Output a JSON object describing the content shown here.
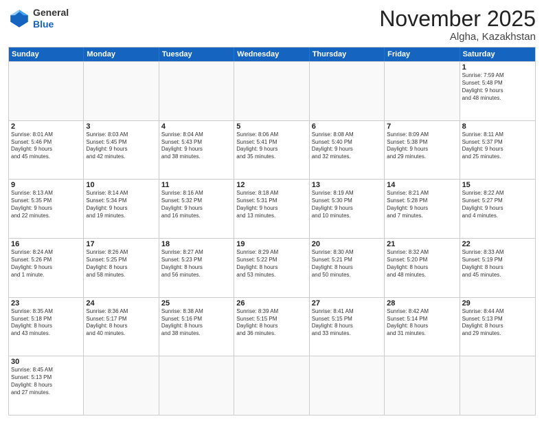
{
  "header": {
    "logo_general": "General",
    "logo_blue": "Blue",
    "month_title": "November 2025",
    "location": "Algha, Kazakhstan"
  },
  "days_of_week": [
    "Sunday",
    "Monday",
    "Tuesday",
    "Wednesday",
    "Thursday",
    "Friday",
    "Saturday"
  ],
  "rows": [
    [
      {
        "day": "",
        "info": ""
      },
      {
        "day": "",
        "info": ""
      },
      {
        "day": "",
        "info": ""
      },
      {
        "day": "",
        "info": ""
      },
      {
        "day": "",
        "info": ""
      },
      {
        "day": "",
        "info": ""
      },
      {
        "day": "1",
        "info": "Sunrise: 7:59 AM\nSunset: 5:48 PM\nDaylight: 9 hours\nand 48 minutes."
      }
    ],
    [
      {
        "day": "2",
        "info": "Sunrise: 8:01 AM\nSunset: 5:46 PM\nDaylight: 9 hours\nand 45 minutes."
      },
      {
        "day": "3",
        "info": "Sunrise: 8:03 AM\nSunset: 5:45 PM\nDaylight: 9 hours\nand 42 minutes."
      },
      {
        "day": "4",
        "info": "Sunrise: 8:04 AM\nSunset: 5:43 PM\nDaylight: 9 hours\nand 38 minutes."
      },
      {
        "day": "5",
        "info": "Sunrise: 8:06 AM\nSunset: 5:41 PM\nDaylight: 9 hours\nand 35 minutes."
      },
      {
        "day": "6",
        "info": "Sunrise: 8:08 AM\nSunset: 5:40 PM\nDaylight: 9 hours\nand 32 minutes."
      },
      {
        "day": "7",
        "info": "Sunrise: 8:09 AM\nSunset: 5:38 PM\nDaylight: 9 hours\nand 29 minutes."
      },
      {
        "day": "8",
        "info": "Sunrise: 8:11 AM\nSunset: 5:37 PM\nDaylight: 9 hours\nand 25 minutes."
      }
    ],
    [
      {
        "day": "9",
        "info": "Sunrise: 8:13 AM\nSunset: 5:35 PM\nDaylight: 9 hours\nand 22 minutes."
      },
      {
        "day": "10",
        "info": "Sunrise: 8:14 AM\nSunset: 5:34 PM\nDaylight: 9 hours\nand 19 minutes."
      },
      {
        "day": "11",
        "info": "Sunrise: 8:16 AM\nSunset: 5:32 PM\nDaylight: 9 hours\nand 16 minutes."
      },
      {
        "day": "12",
        "info": "Sunrise: 8:18 AM\nSunset: 5:31 PM\nDaylight: 9 hours\nand 13 minutes."
      },
      {
        "day": "13",
        "info": "Sunrise: 8:19 AM\nSunset: 5:30 PM\nDaylight: 9 hours\nand 10 minutes."
      },
      {
        "day": "14",
        "info": "Sunrise: 8:21 AM\nSunset: 5:28 PM\nDaylight: 9 hours\nand 7 minutes."
      },
      {
        "day": "15",
        "info": "Sunrise: 8:22 AM\nSunset: 5:27 PM\nDaylight: 9 hours\nand 4 minutes."
      }
    ],
    [
      {
        "day": "16",
        "info": "Sunrise: 8:24 AM\nSunset: 5:26 PM\nDaylight: 9 hours\nand 1 minute."
      },
      {
        "day": "17",
        "info": "Sunrise: 8:26 AM\nSunset: 5:25 PM\nDaylight: 8 hours\nand 58 minutes."
      },
      {
        "day": "18",
        "info": "Sunrise: 8:27 AM\nSunset: 5:23 PM\nDaylight: 8 hours\nand 56 minutes."
      },
      {
        "day": "19",
        "info": "Sunrise: 8:29 AM\nSunset: 5:22 PM\nDaylight: 8 hours\nand 53 minutes."
      },
      {
        "day": "20",
        "info": "Sunrise: 8:30 AM\nSunset: 5:21 PM\nDaylight: 8 hours\nand 50 minutes."
      },
      {
        "day": "21",
        "info": "Sunrise: 8:32 AM\nSunset: 5:20 PM\nDaylight: 8 hours\nand 48 minutes."
      },
      {
        "day": "22",
        "info": "Sunrise: 8:33 AM\nSunset: 5:19 PM\nDaylight: 8 hours\nand 45 minutes."
      }
    ],
    [
      {
        "day": "23",
        "info": "Sunrise: 8:35 AM\nSunset: 5:18 PM\nDaylight: 8 hours\nand 43 minutes."
      },
      {
        "day": "24",
        "info": "Sunrise: 8:36 AM\nSunset: 5:17 PM\nDaylight: 8 hours\nand 40 minutes."
      },
      {
        "day": "25",
        "info": "Sunrise: 8:38 AM\nSunset: 5:16 PM\nDaylight: 8 hours\nand 38 minutes."
      },
      {
        "day": "26",
        "info": "Sunrise: 8:39 AM\nSunset: 5:15 PM\nDaylight: 8 hours\nand 36 minutes."
      },
      {
        "day": "27",
        "info": "Sunrise: 8:41 AM\nSunset: 5:15 PM\nDaylight: 8 hours\nand 33 minutes."
      },
      {
        "day": "28",
        "info": "Sunrise: 8:42 AM\nSunset: 5:14 PM\nDaylight: 8 hours\nand 31 minutes."
      },
      {
        "day": "29",
        "info": "Sunrise: 8:44 AM\nSunset: 5:13 PM\nDaylight: 8 hours\nand 29 minutes."
      }
    ],
    [
      {
        "day": "30",
        "info": "Sunrise: 8:45 AM\nSunset: 5:13 PM\nDaylight: 8 hours\nand 27 minutes."
      },
      {
        "day": "",
        "info": ""
      },
      {
        "day": "",
        "info": ""
      },
      {
        "day": "",
        "info": ""
      },
      {
        "day": "",
        "info": ""
      },
      {
        "day": "",
        "info": ""
      },
      {
        "day": "",
        "info": ""
      }
    ]
  ]
}
